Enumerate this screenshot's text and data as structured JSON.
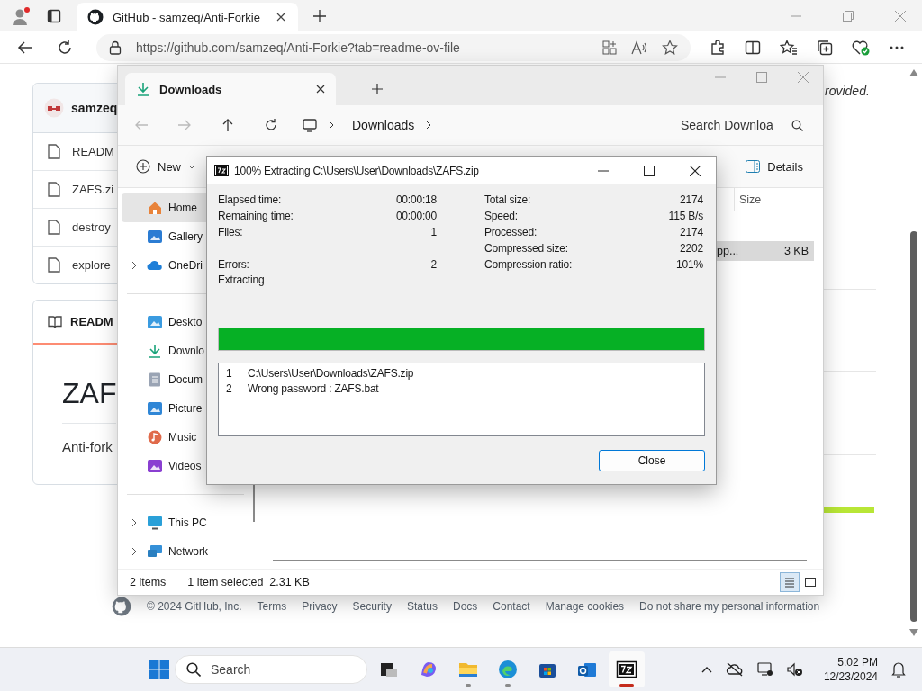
{
  "browser": {
    "tab_title": "GitHub - samzeq/Anti-Forkie",
    "url": "https://github.com/samzeq/Anti-Forkie?tab=readme-ov-file"
  },
  "github": {
    "owner": "samzeq",
    "files": [
      "READM",
      "ZAFS.zi",
      "destroy",
      "explore"
    ],
    "readme_tab": "READM",
    "heading": "ZAF",
    "description": "Anti-fork",
    "side_text": "rovided.",
    "footer": [
      "© 2024 GitHub, Inc.",
      "Terms",
      "Privacy",
      "Security",
      "Status",
      "Docs",
      "Contact",
      "Manage cookies",
      "Do not share my personal information"
    ]
  },
  "explorer": {
    "tab_title": "Downloads",
    "breadcrumb": "Downloads",
    "search": {
      "placeholder": "Search Downloa"
    },
    "new_button": "New",
    "details_button": "Details",
    "nav_groups": [
      [
        {
          "label": "Home",
          "selected": true,
          "expandable": false
        },
        {
          "label": "Gallery",
          "selected": false,
          "expandable": false
        },
        {
          "label": "OneDri",
          "selected": false,
          "expandable": true
        }
      ],
      [
        {
          "label": "Deskto",
          "selected": false,
          "expandable": false
        },
        {
          "label": "Downlo",
          "selected": false,
          "expandable": false
        },
        {
          "label": "Docum",
          "selected": false,
          "expandable": false
        },
        {
          "label": "Picture",
          "selected": false,
          "expandable": false
        },
        {
          "label": "Music",
          "selected": false,
          "expandable": false
        },
        {
          "label": "Videos",
          "selected": false,
          "expandable": false
        }
      ],
      [
        {
          "label": "This PC",
          "selected": false,
          "expandable": true
        },
        {
          "label": "Network",
          "selected": false,
          "expandable": true
        }
      ]
    ],
    "columns": [
      "Size"
    ],
    "rows": [
      {
        "name": "pp...",
        "size": "3 KB",
        "selected": true
      }
    ],
    "status": {
      "count": "2 items",
      "selection": "1 item selected  2.31 KB"
    }
  },
  "dialog": {
    "title": "100% Extracting C:\\Users\\User\\Downloads\\ZAFS.zip",
    "stats": [
      {
        "left_label": "Elapsed time:",
        "left_value": "00:00:18",
        "right_label": "Total size:",
        "right_value": "2174"
      },
      {
        "left_label": "Remaining time:",
        "left_value": "00:00:00",
        "right_label": "Speed:",
        "right_value": "115 B/s"
      },
      {
        "left_label": "Files:",
        "left_value": "1",
        "right_label": "Processed:",
        "right_value": "2174"
      },
      {
        "right_label": "Compressed size:",
        "right_value": "2202"
      },
      {
        "left_label": "Errors:",
        "left_value": "2",
        "right_label": "Compression ratio:",
        "right_value": "101%"
      }
    ],
    "status": "Extracting",
    "progress": {
      "level": 1.0
    },
    "log": [
      {
        "number": "1",
        "text": "C:\\Users\\User\\Downloads\\ZAFS.zip"
      },
      {
        "number": "2",
        "text": "Wrong password : ZAFS.bat"
      }
    ],
    "close_button": "Close"
  },
  "taskbar": {
    "search": {
      "placeholder": "Search"
    },
    "apps": [
      {
        "kind": "taskview",
        "running": false,
        "active": false
      },
      {
        "kind": "copilot",
        "running": false,
        "active": false
      },
      {
        "kind": "files",
        "running": true,
        "active": false
      },
      {
        "kind": "edge",
        "running": true,
        "active": false
      },
      {
        "kind": "store",
        "running": false,
        "active": false
      },
      {
        "kind": "outlook",
        "running": false,
        "active": false
      },
      {
        "kind": "sevenzip",
        "running": true,
        "active": true
      }
    ],
    "time": "5:02 PM",
    "date": "12/23/2024"
  }
}
